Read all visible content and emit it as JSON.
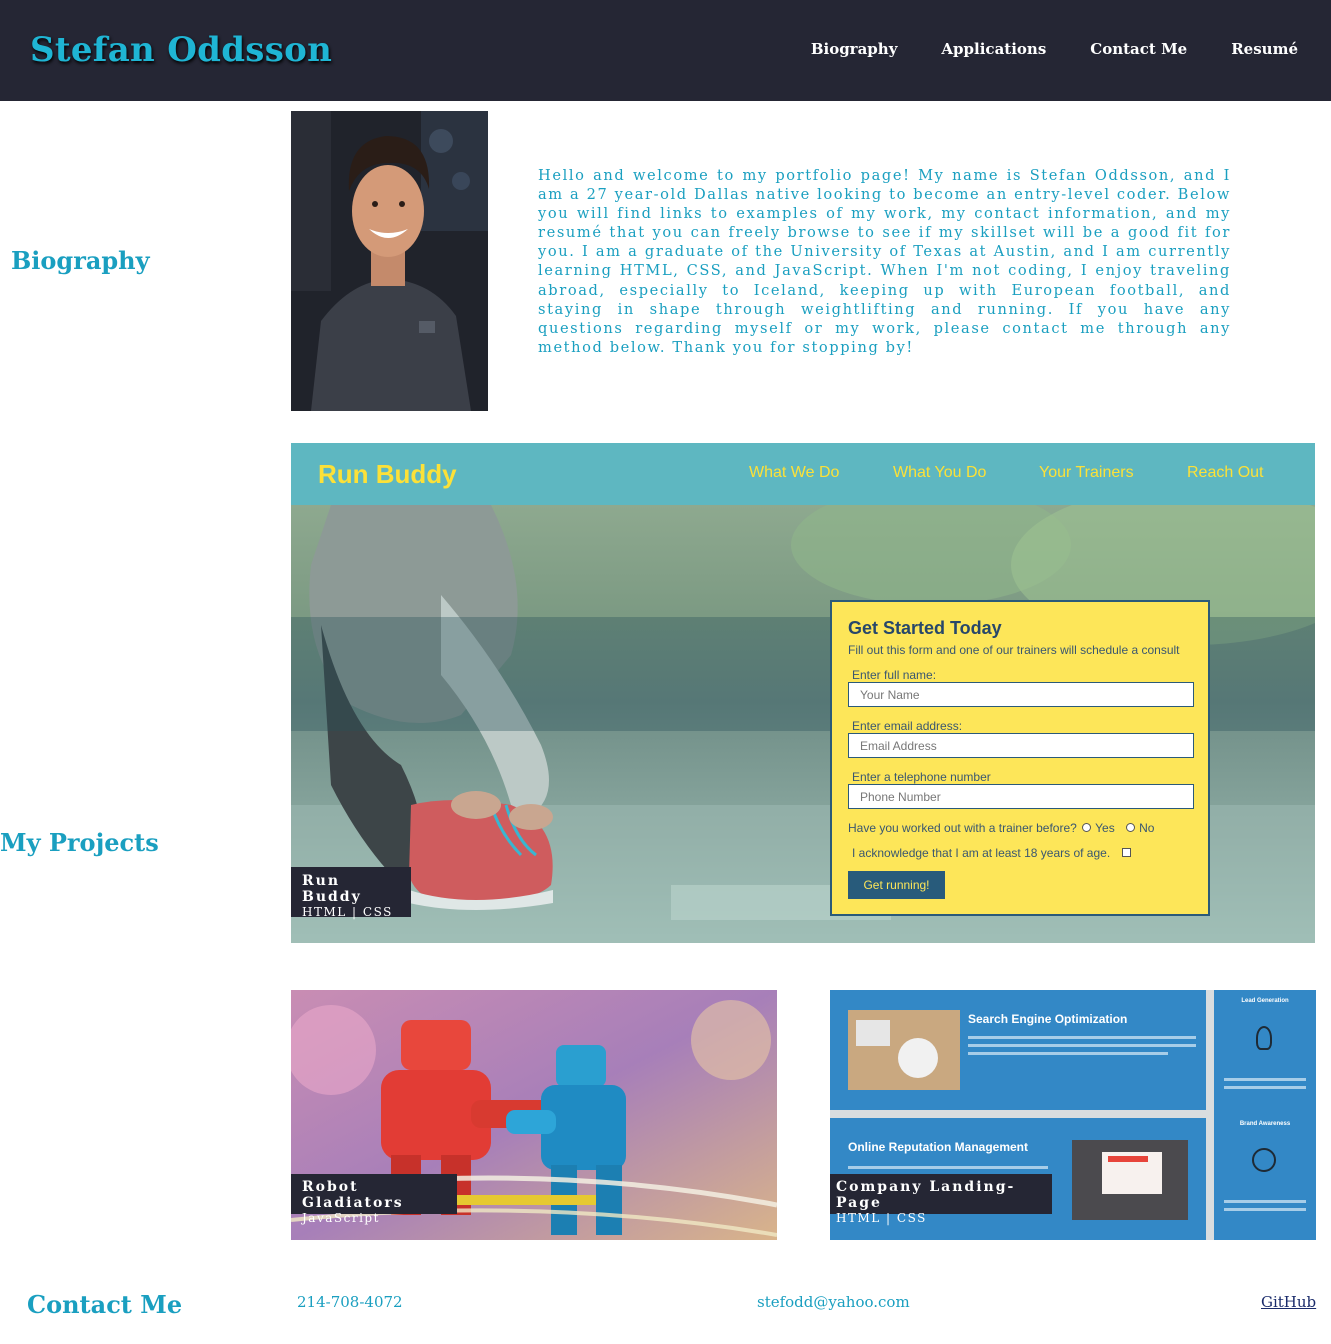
{
  "header": {
    "title": "Stefan Oddsson",
    "nav": [
      "Biography",
      "Applications",
      "Contact Me",
      "Resumé"
    ]
  },
  "biography": {
    "heading": "Biography",
    "text": "Hello and welcome to my portfolio page! My name is Stefan Oddsson, and I am a 27 year-old Dallas native looking to become an entry-level coder. Below you will find links to examples of my work, my contact information, and my resumé that you can freely browse to see if my skillset will be a good fit for you. I am a graduate of the University of Texas at Austin, and I am currently learning HTML, CSS, and JavaScript. When I'm not coding, I enjoy traveling abroad, especially to Iceland, keeping up with European football, and staying in shape through weightlifting and running. If you have any questions regarding myself or my work, please contact me through any method below. Thank you for stopping by!"
  },
  "projects": {
    "heading": "My Projects",
    "items": [
      {
        "name": "Run Buddy",
        "tech": "HTML | CSS"
      },
      {
        "name": "Robot Gladiators",
        "tech": "JavaScript"
      },
      {
        "name": "Company Landing-Page",
        "tech": "HTML | CSS"
      }
    ],
    "run_buddy_preview": {
      "logo": "Run Buddy",
      "nav": [
        "What We Do",
        "What You Do",
        "Your Trainers",
        "Reach Out"
      ],
      "form_title": "Get Started Today",
      "form_sub": "Fill out this form and one of our trainers will schedule a consult",
      "name_label": "Enter full name:",
      "name_placeholder": "Your Name",
      "email_label": "Enter email address:",
      "email_placeholder": "Email Address",
      "phone_label": "Enter a telephone number",
      "phone_placeholder": "Phone Number",
      "trainer_q": "Have you worked out with a trainer before?",
      "yes": "Yes",
      "no": "No",
      "ack": "I acknowledge that I am at least 18 years of age.",
      "button": "Get running!"
    },
    "landing_preview": {
      "seo_title": "Search Engine Optimization",
      "orm_title": "Online Reputation Management",
      "lead_gen": "Lead Generation",
      "brand": "Brand Awareness"
    }
  },
  "contact": {
    "heading": "Contact Me",
    "phone": "214-708-4072",
    "email": "stefodd@yahoo.com",
    "github": "GitHub"
  },
  "colors": {
    "header_bg": "#252634",
    "accent": "#1a9fc0",
    "runbuddy_yellow": "#fce138",
    "runbuddy_teal": "#5eb7c1"
  }
}
